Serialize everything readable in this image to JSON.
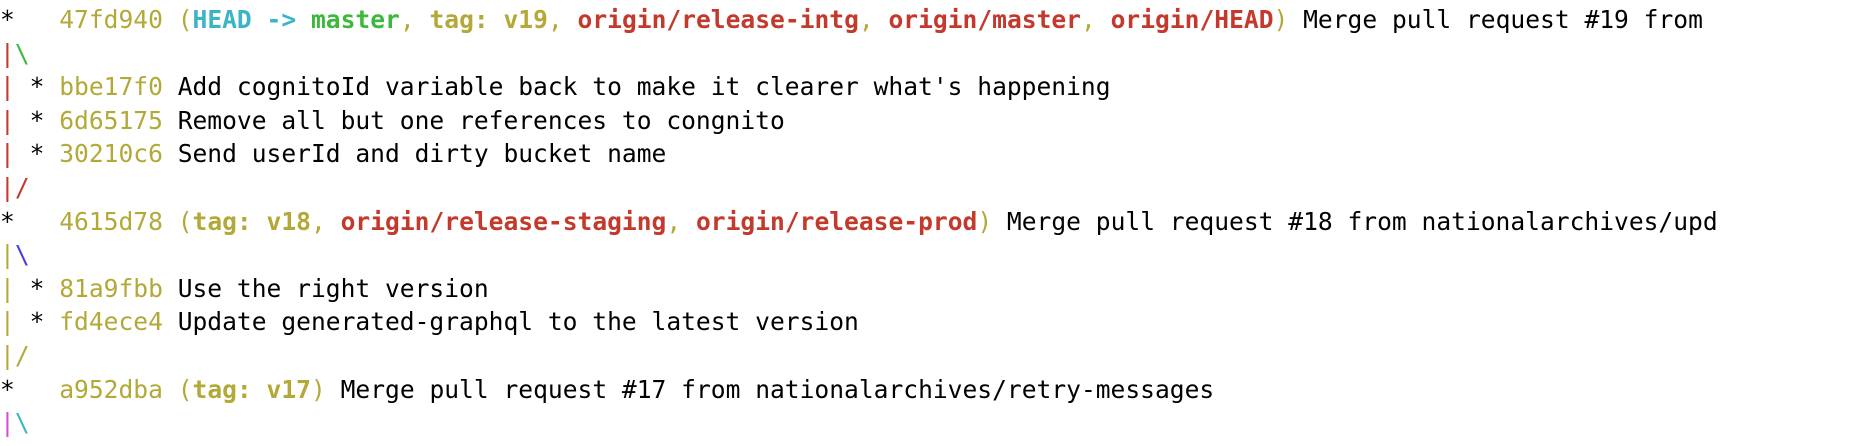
{
  "colors": {
    "hash": "#b3a939",
    "head": "#3bb5c6",
    "branch": "#3cb83c",
    "remote": "#c3392c",
    "tag": "#b3a939",
    "text": "#000000",
    "graph_red": "#c3392c",
    "graph_green": "#3cb83c",
    "graph_yellow": "#b3a939",
    "graph_blue": "#4a3ee0",
    "graph_magenta": "#d54fd5",
    "graph_cyan": "#3bb5c6"
  },
  "lines": [
    {
      "kind": "commit",
      "segments": [
        {
          "text": "*   ",
          "color": "text"
        },
        {
          "text": "47fd940 ",
          "color": "hash"
        },
        {
          "text": "(",
          "color": "hash"
        },
        {
          "text": "HEAD -> ",
          "color": "head",
          "bold": true
        },
        {
          "text": "master",
          "color": "branch",
          "bold": true
        },
        {
          "text": ", ",
          "color": "hash"
        },
        {
          "text": "tag: v19",
          "color": "tag",
          "bold": true
        },
        {
          "text": ", ",
          "color": "hash"
        },
        {
          "text": "origin/release-intg",
          "color": "remote",
          "bold": true
        },
        {
          "text": ", ",
          "color": "hash"
        },
        {
          "text": "origin/master",
          "color": "remote",
          "bold": true
        },
        {
          "text": ", ",
          "color": "hash"
        },
        {
          "text": "origin/HEAD",
          "color": "remote",
          "bold": true
        },
        {
          "text": ")",
          "color": "hash"
        },
        {
          "text": " Merge pull request #19 from",
          "color": "text"
        }
      ]
    },
    {
      "kind": "graph",
      "segments": [
        {
          "text": "|",
          "color": "graph_red"
        },
        {
          "text": "\\",
          "color": "graph_green"
        }
      ]
    },
    {
      "kind": "commit",
      "segments": [
        {
          "text": "|",
          "color": "graph_red"
        },
        {
          "text": " * ",
          "color": "text"
        },
        {
          "text": "bbe17f0",
          "color": "hash"
        },
        {
          "text": " Add cognitoId variable back to make it clearer what's happening",
          "color": "text"
        }
      ]
    },
    {
      "kind": "commit",
      "segments": [
        {
          "text": "|",
          "color": "graph_red"
        },
        {
          "text": " * ",
          "color": "text"
        },
        {
          "text": "6d65175",
          "color": "hash"
        },
        {
          "text": " Remove all but one references to congnito",
          "color": "text"
        }
      ]
    },
    {
      "kind": "commit",
      "segments": [
        {
          "text": "|",
          "color": "graph_red"
        },
        {
          "text": " * ",
          "color": "text"
        },
        {
          "text": "30210c6",
          "color": "hash"
        },
        {
          "text": " Send userId and dirty bucket name",
          "color": "text"
        }
      ]
    },
    {
      "kind": "graph",
      "segments": [
        {
          "text": "|",
          "color": "graph_red"
        },
        {
          "text": "/",
          "color": "graph_red"
        }
      ]
    },
    {
      "kind": "commit",
      "segments": [
        {
          "text": "*   ",
          "color": "text"
        },
        {
          "text": "4615d78 ",
          "color": "hash"
        },
        {
          "text": "(",
          "color": "hash"
        },
        {
          "text": "tag: v18",
          "color": "tag",
          "bold": true
        },
        {
          "text": ", ",
          "color": "hash"
        },
        {
          "text": "origin/release-staging",
          "color": "remote",
          "bold": true
        },
        {
          "text": ", ",
          "color": "hash"
        },
        {
          "text": "origin/release-prod",
          "color": "remote",
          "bold": true
        },
        {
          "text": ")",
          "color": "hash"
        },
        {
          "text": " Merge pull request #18 from nationalarchives/upd",
          "color": "text"
        }
      ]
    },
    {
      "kind": "graph",
      "segments": [
        {
          "text": "|",
          "color": "graph_yellow"
        },
        {
          "text": "\\",
          "color": "graph_blue"
        }
      ]
    },
    {
      "kind": "commit",
      "segments": [
        {
          "text": "|",
          "color": "graph_yellow"
        },
        {
          "text": " * ",
          "color": "text"
        },
        {
          "text": "81a9fbb",
          "color": "hash"
        },
        {
          "text": " Use the right version",
          "color": "text"
        }
      ]
    },
    {
      "kind": "commit",
      "segments": [
        {
          "text": "|",
          "color": "graph_yellow"
        },
        {
          "text": " * ",
          "color": "text"
        },
        {
          "text": "fd4ece4",
          "color": "hash"
        },
        {
          "text": " Update generated-graphql to the latest version",
          "color": "text"
        }
      ]
    },
    {
      "kind": "graph",
      "segments": [
        {
          "text": "|",
          "color": "graph_yellow"
        },
        {
          "text": "/",
          "color": "graph_yellow"
        }
      ]
    },
    {
      "kind": "commit",
      "segments": [
        {
          "text": "*   ",
          "color": "text"
        },
        {
          "text": "a952dba ",
          "color": "hash"
        },
        {
          "text": "(",
          "color": "hash"
        },
        {
          "text": "tag: v17",
          "color": "tag",
          "bold": true
        },
        {
          "text": ")",
          "color": "hash"
        },
        {
          "text": " Merge pull request #17 from nationalarchives/retry-messages",
          "color": "text"
        }
      ]
    },
    {
      "kind": "graph",
      "segments": [
        {
          "text": "|",
          "color": "graph_magenta"
        },
        {
          "text": "\\",
          "color": "graph_cyan"
        }
      ]
    }
  ]
}
